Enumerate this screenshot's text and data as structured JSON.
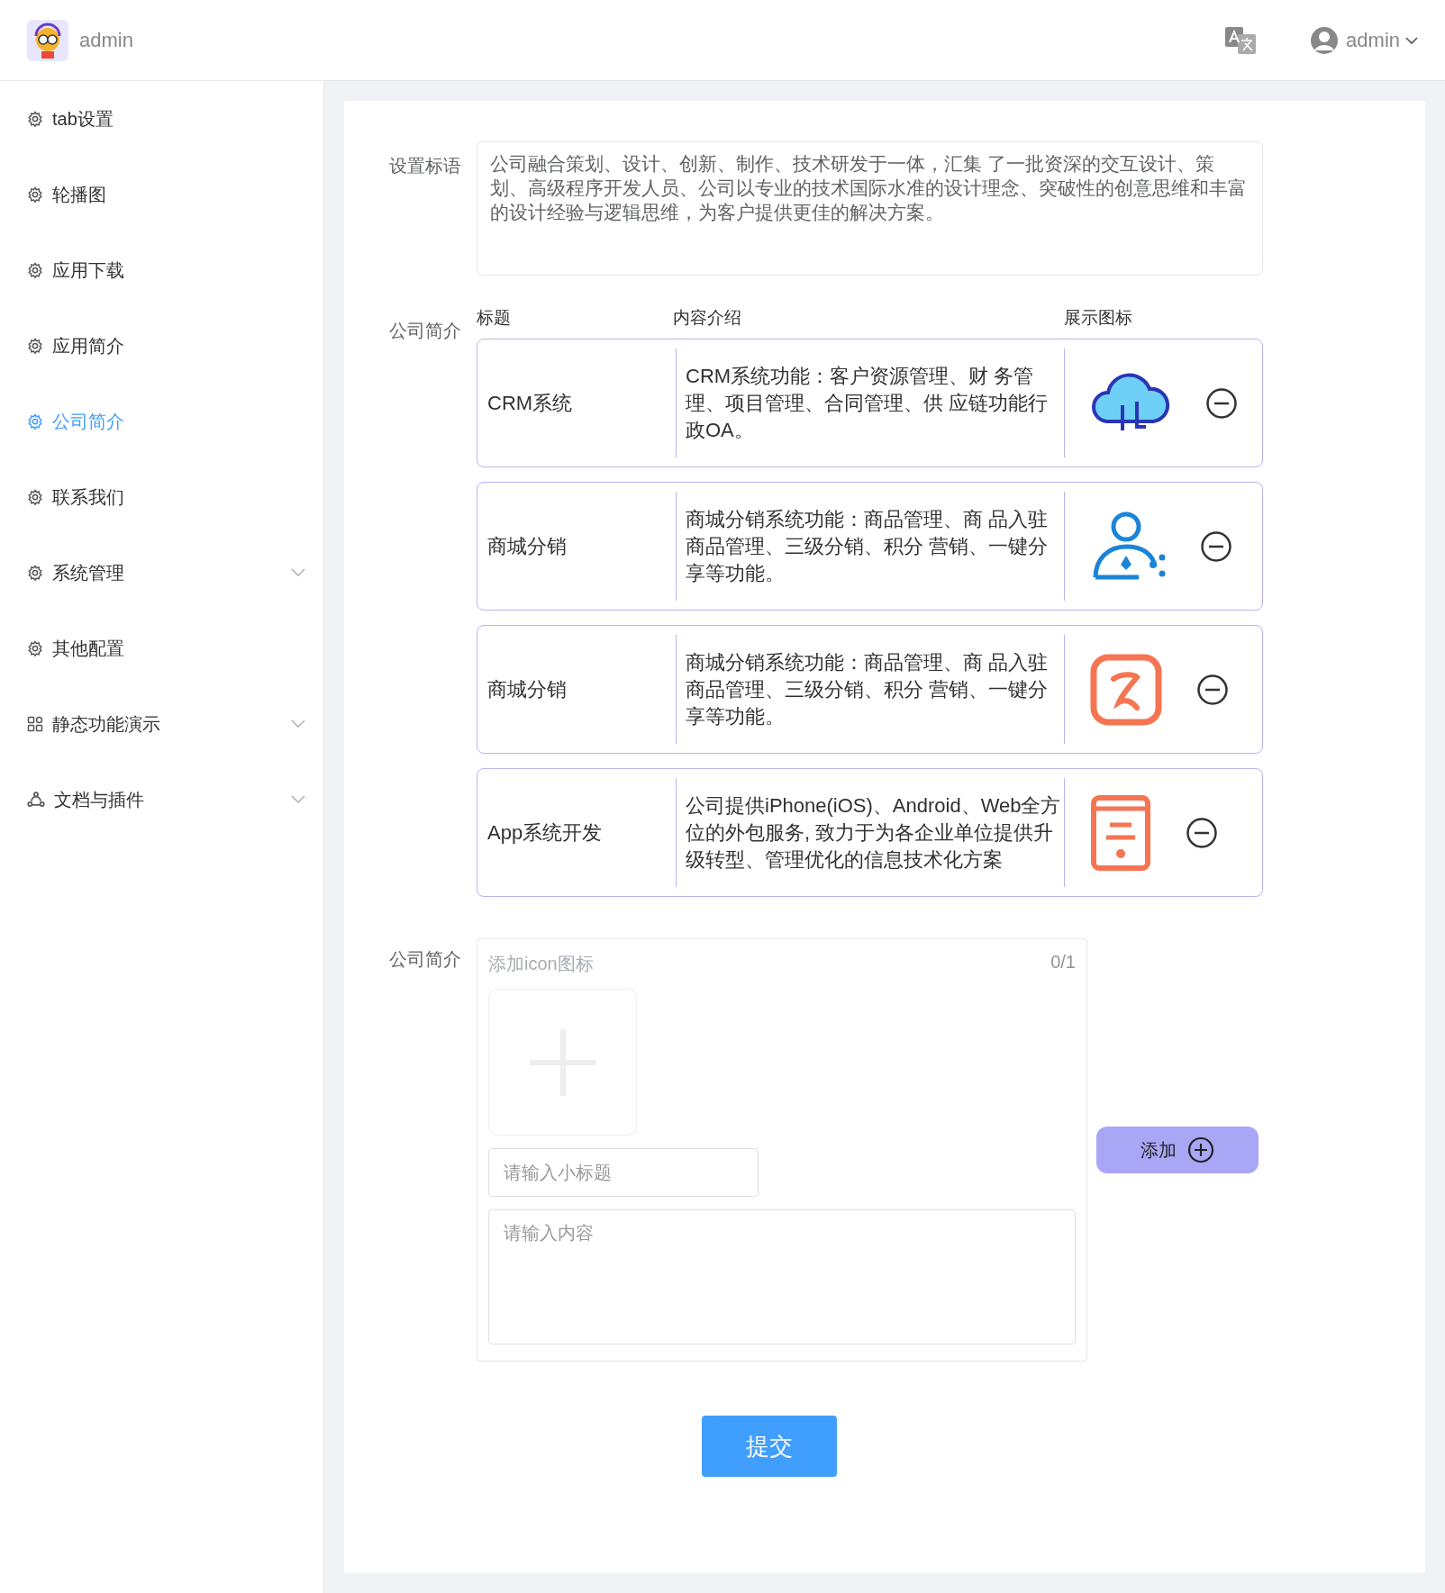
{
  "header": {
    "brand": "admin",
    "user": "admin"
  },
  "sidebar": {
    "items": [
      {
        "label": "tab设置",
        "kind": "gear",
        "selected": false,
        "expandable": false
      },
      {
        "label": "轮播图",
        "kind": "gear",
        "selected": false,
        "expandable": false
      },
      {
        "label": "应用下载",
        "kind": "gear",
        "selected": false,
        "expandable": false
      },
      {
        "label": "应用简介",
        "kind": "gear",
        "selected": false,
        "expandable": false
      },
      {
        "label": "公司简介",
        "kind": "gear",
        "selected": true,
        "expandable": false
      },
      {
        "label": "联系我们",
        "kind": "gear",
        "selected": false,
        "expandable": false
      },
      {
        "label": "系统管理",
        "kind": "gear",
        "selected": false,
        "expandable": true
      },
      {
        "label": "其他配置",
        "kind": "gear",
        "selected": false,
        "expandable": false
      },
      {
        "label": "静态功能演示",
        "kind": "grid",
        "selected": false,
        "expandable": true
      },
      {
        "label": "文档与插件",
        "kind": "bell",
        "selected": false,
        "expandable": true
      }
    ]
  },
  "slogan": {
    "label": "设置标语",
    "value": "公司融合策划、设计、创新、制作、技术研发于一体，汇集 了一批资深的交互设计、策划、高级程序开发人员、公司以专业的技术国际水准的设计理念、突破性的创意思维和丰富的设计经验与逻辑思维，为客户提供更佳的解决方案。"
  },
  "intro": {
    "label": "公司简介",
    "columns": [
      "标题",
      "内容介绍",
      "展示图标"
    ],
    "rows": [
      {
        "title": "CRM系统",
        "content": "CRM系统功能：客户资源管理、财 务管理、项目管理、合同管理、供 应链功能行政OA。",
        "kind": "cloud"
      },
      {
        "title": "商城分销",
        "content": "商城分销系统功能：商品管理、商 品入驻商品管理、三级分销、积分 营销、一键分享等功能。",
        "kind": "person"
      },
      {
        "title": "商城分销",
        "content": "商城分销系统功能：商品管理、商 品入驻商品管理、三级分销、积分 营销、一键分享等功能。",
        "kind": "badge"
      },
      {
        "title": "App系统开发",
        "content": "公司提供iPhone(iOS)、Android、Web全方位的外包服务, 致力于为各企业单位提供升级转型、管理优化的信息技术化方案",
        "kind": "tablet"
      }
    ]
  },
  "new_item": {
    "label": "公司简介",
    "upload_label": "添加icon图标",
    "upload_count": "0/1",
    "title_placeholder": "请输入小标题",
    "content_placeholder": "请输入内容",
    "add_button": "添加"
  },
  "submit": "提交"
}
